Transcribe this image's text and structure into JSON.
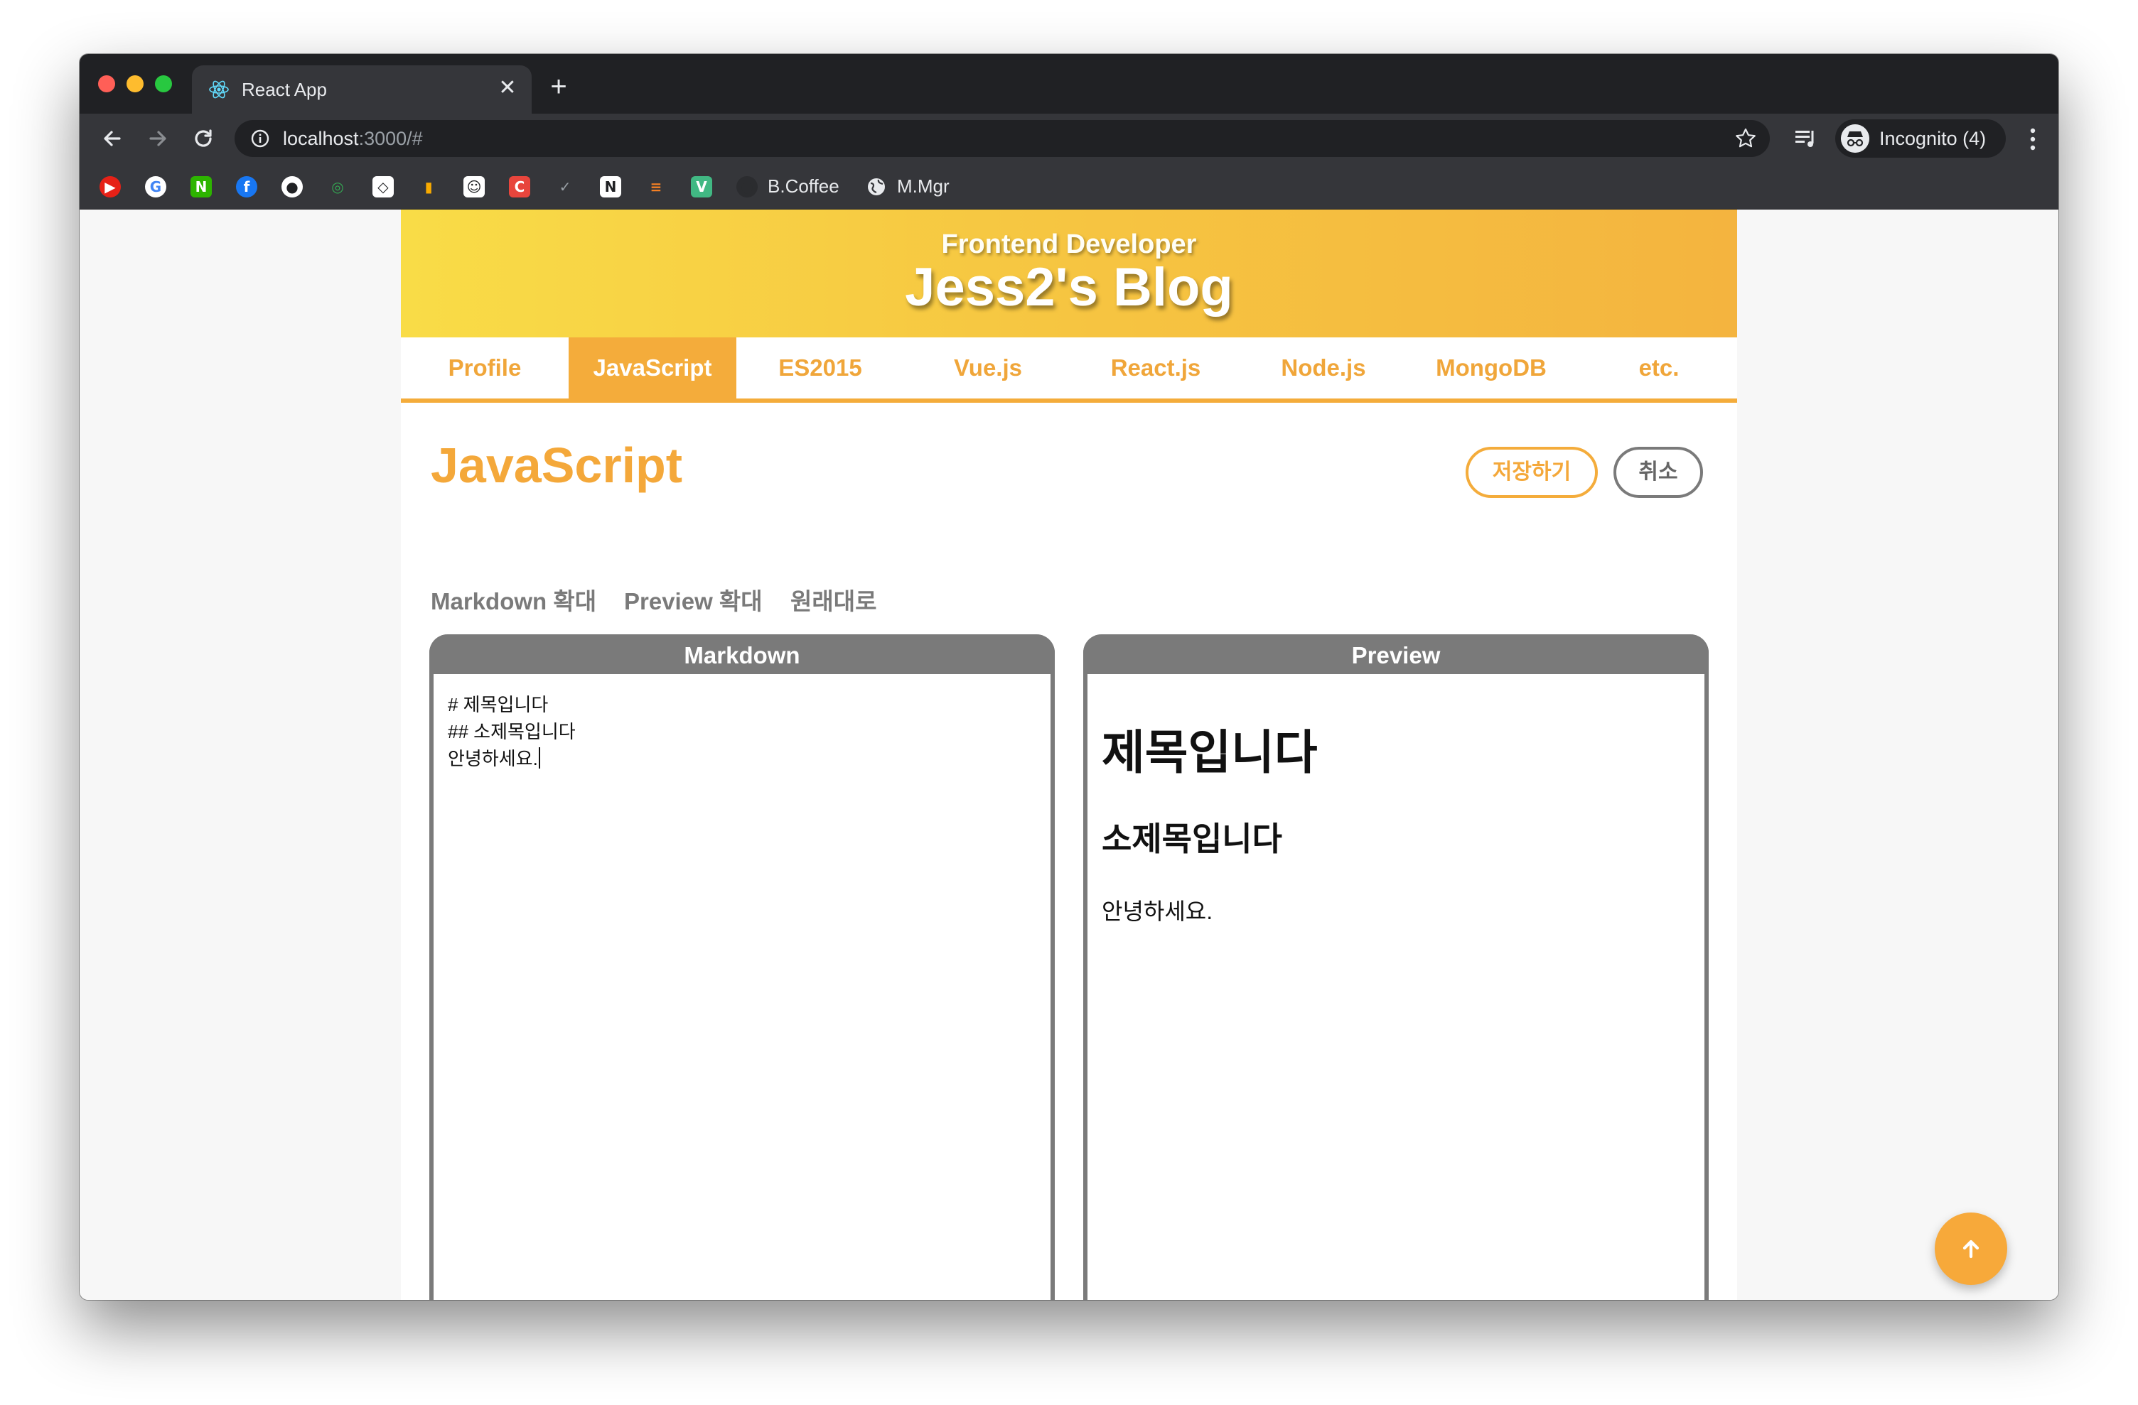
{
  "browser": {
    "tab_title": "React App",
    "tab_close_icon": "close-icon",
    "new_tab_icon": "plus-icon",
    "url_host": "localhost",
    "url_rest": ":3000/#",
    "profile_label": "Incognito (4)"
  },
  "bookmarks": {
    "items": [
      {
        "icon": "youtube-icon",
        "color": "#e62117"
      },
      {
        "icon": "google-icon",
        "color": "#ffffff"
      },
      {
        "icon": "naver-icon",
        "color": "#2db400"
      },
      {
        "icon": "facebook-icon",
        "color": "#1877f2"
      },
      {
        "icon": "github-icon",
        "color": "#ffffff"
      },
      {
        "icon": "search-icon",
        "color": "#34a853"
      },
      {
        "icon": "codepen-icon",
        "color": "#ffffff"
      },
      {
        "icon": "analytics-icon",
        "color": "#f9ab00"
      },
      {
        "icon": "portrait-icon",
        "color": "#ffffff"
      },
      {
        "icon": "c-icon",
        "color": "#e8453c"
      },
      {
        "icon": "check-icon",
        "color": "#5f6368"
      },
      {
        "icon": "notion-icon",
        "color": "#ffffff"
      },
      {
        "icon": "stack-icon",
        "color": "#f48024"
      },
      {
        "icon": "vue-icon",
        "color": "#41b883"
      },
      {
        "icon": "coffee-icon",
        "color": "#3c4043"
      }
    ],
    "coffee_label": "B.Coffee",
    "mgr_label": "M.Mgr"
  },
  "header": {
    "subtitle": "Frontend Developer",
    "title": "Jess2's Blog"
  },
  "nav": {
    "tabs": [
      "Profile",
      "JavaScript",
      "ES2015",
      "Vue.js",
      "React.js",
      "Node.js",
      "MongoDB",
      "etc."
    ],
    "active": "JavaScript"
  },
  "editor": {
    "page_title": "JavaScript",
    "save_label": "저장하기",
    "cancel_label": "취소",
    "view_options": [
      "Markdown 확대",
      "Preview 확대",
      "원래대로"
    ],
    "markdown_header": "Markdown",
    "preview_header": "Preview",
    "markdown_lines": [
      "# 제목입니다",
      "## 소제목입니다",
      "안녕하세요."
    ],
    "preview": {
      "h1": "제목입니다",
      "h2": "소제목입니다",
      "p": "안녕하세요."
    }
  },
  "fab": {
    "icon": "arrow-up-icon"
  },
  "colors": {
    "accent": "#f4ac3b",
    "header_gradient_start": "#f9dc47",
    "header_gradient_end": "#f4b43f",
    "panel_border": "#7a7a7a"
  }
}
